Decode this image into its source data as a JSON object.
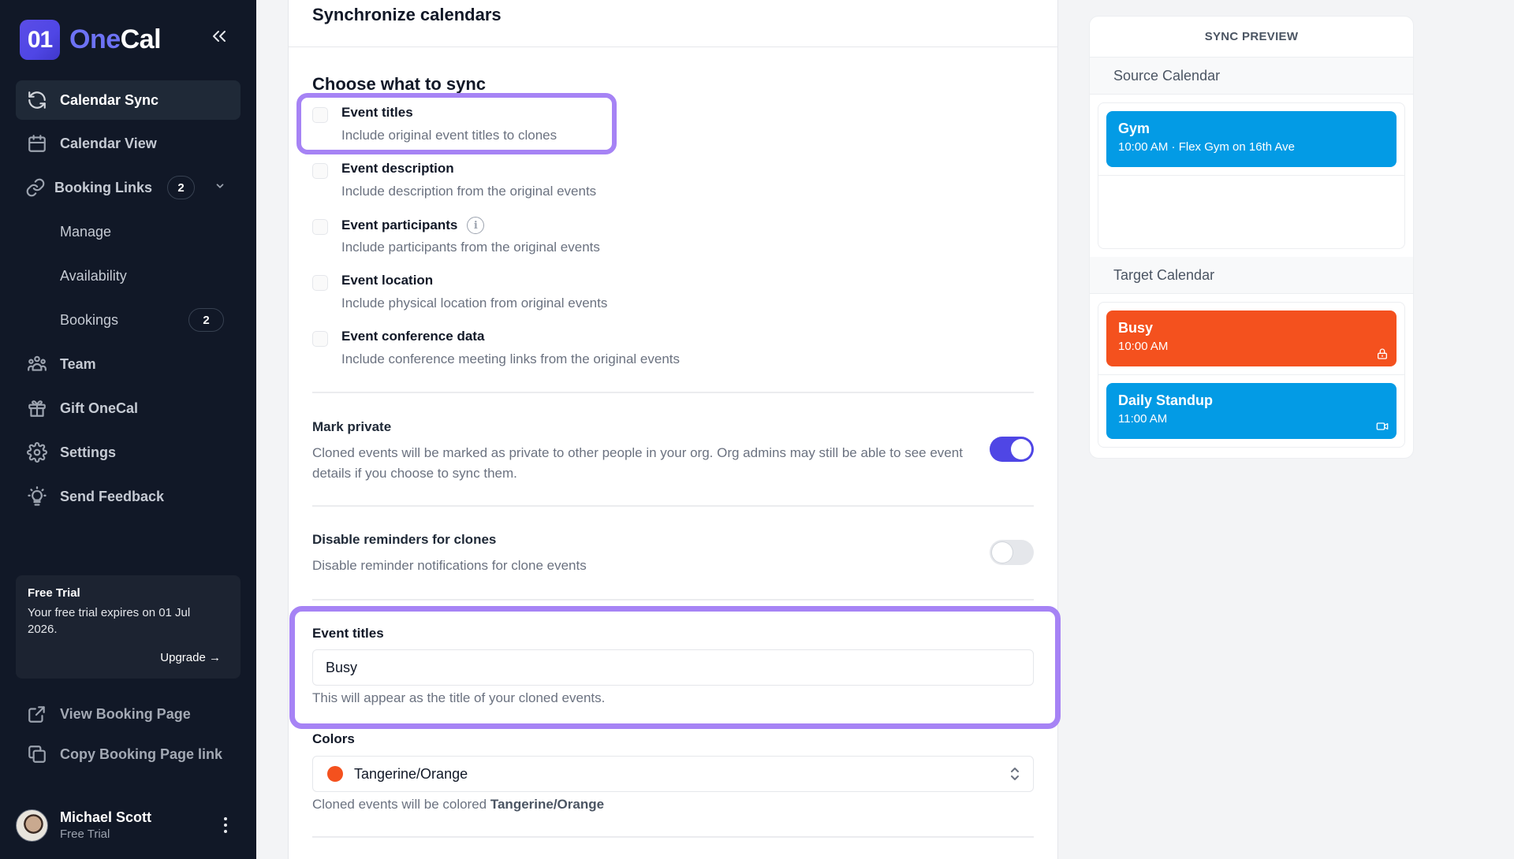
{
  "sidebar": {
    "logo_mark": "01",
    "logo_one": "One",
    "logo_cal": "Cal",
    "collapse_label": "«",
    "items": [
      {
        "label": "Calendar Sync",
        "icon": "sync-icon",
        "active": true
      },
      {
        "label": "Calendar View",
        "icon": "calendar-icon"
      },
      {
        "label": "Booking Links",
        "icon": "link-icon",
        "badge": "2"
      },
      {
        "label": "Team",
        "icon": "team-icon"
      },
      {
        "label": "Gift OneCal",
        "icon": "gift-icon"
      },
      {
        "label": "Settings",
        "icon": "gear-icon"
      },
      {
        "label": "Send Feedback",
        "icon": "lightbulb-icon"
      }
    ],
    "sub_items": [
      {
        "label": "Manage"
      },
      {
        "label": "Availability"
      },
      {
        "label": "Bookings",
        "badge": "2"
      }
    ],
    "trial": {
      "title": "Free Trial",
      "text": "Your free trial expires on 01 Jul 2026.",
      "upgrade": "Upgrade →"
    },
    "footer_links": [
      {
        "label": "View Booking Page",
        "icon": "external-link-icon"
      },
      {
        "label": "Copy Booking Page link",
        "icon": "copy-icon"
      }
    ],
    "user": {
      "name": "Michael Scott",
      "plan": "Free Trial"
    }
  },
  "main": {
    "page_title": "Synchronize calendars",
    "section_title": "Choose what to sync",
    "options": [
      {
        "title": "Event titles",
        "desc": "Include original event titles to clones",
        "checked": false
      },
      {
        "title": "Event description",
        "desc": "Include description from the original events",
        "checked": false
      },
      {
        "title": "Event participants",
        "desc": "Include participants from the original events",
        "checked": false,
        "info": true
      },
      {
        "title": "Event location",
        "desc": "Include physical location from original events",
        "checked": false
      },
      {
        "title": "Event conference data",
        "desc": "Include conference meeting links from the original events",
        "checked": false
      }
    ],
    "mark_private": {
      "title": "Mark private",
      "desc": "Cloned events will be marked as private to other people in your org. Org admins may still be able to see event details if you choose to sync them.",
      "on": true
    },
    "disable_reminders": {
      "title": "Disable reminders for clones",
      "desc": "Disable reminder notifications for clone events",
      "on": false
    },
    "event_titles_field": {
      "label": "Event titles",
      "value": "Busy",
      "help": "This will appear as the title of your cloned events."
    },
    "colors_field": {
      "label": "Colors",
      "value": "Tangerine/Orange",
      "color": "#f4511e",
      "help_prefix": "Cloned events will be colored ",
      "help_value": "Tangerine/Orange"
    }
  },
  "preview": {
    "heading": "SYNC PREVIEW",
    "source_label": "Source Calendar",
    "target_label": "Target Calendar",
    "source_events": [
      {
        "name": "Gym",
        "meta": "10:00 AM · Flex Gym on 16th Ave",
        "color": "#039be5"
      }
    ],
    "target_events": [
      {
        "name": "Busy",
        "meta": "10:00 AM",
        "color": "#f4511e",
        "icon": "lock-icon"
      },
      {
        "name": "Daily Standup",
        "meta": "11:00 AM",
        "color": "#039be5",
        "icon": "video-icon"
      }
    ]
  },
  "colors": {
    "accent": "#4f46e5",
    "highlight": "#a683f5",
    "sidebar_bg": "#111827"
  }
}
